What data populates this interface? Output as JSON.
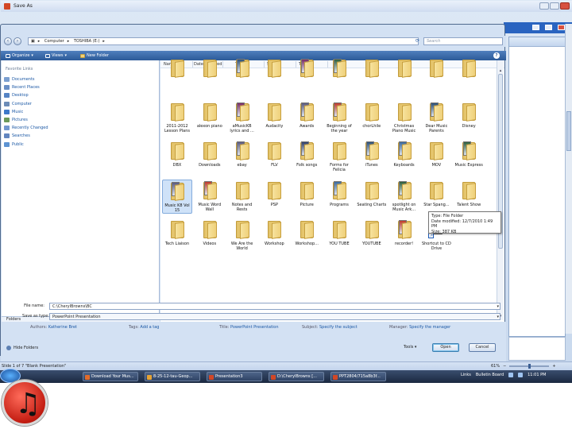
{
  "dialog": {
    "title": "Save As"
  },
  "address": {
    "crumbs": [
      "Computer",
      "TOSHIBA (E:)"
    ],
    "search_placeholder": "Search"
  },
  "toolbar": {
    "organize": "Organize",
    "views": "Views",
    "new_folder": "New Folder"
  },
  "sidebar": {
    "favorites_label": "Favorite Links",
    "items": [
      {
        "label": "Documents",
        "color": "#7b9fd0"
      },
      {
        "label": "Recent Places",
        "color": "#6a8fc6"
      },
      {
        "label": "Desktop",
        "color": "#5584c5"
      },
      {
        "label": "Computer",
        "color": "#6b8cb8"
      },
      {
        "label": "Music",
        "color": "#3d79c9"
      },
      {
        "label": "Pictures",
        "color": "#6b9a5a"
      },
      {
        "label": "Recently Changed",
        "color": "#7197cf"
      },
      {
        "label": "Searches",
        "color": "#6186c0"
      },
      {
        "label": "Public",
        "color": "#5c93d2"
      }
    ],
    "folders_label": "Folders"
  },
  "columns": [
    "Name",
    "Date modified",
    "Type",
    "Size",
    "Tags"
  ],
  "files": [
    {
      "name": "",
      "icon": "folder"
    },
    {
      "name": "",
      "icon": "folder"
    },
    {
      "name": "",
      "icon": "folder-pic"
    },
    {
      "name": "",
      "icon": "folder"
    },
    {
      "name": "",
      "icon": "folder-pic"
    },
    {
      "name": "",
      "icon": "folder-pic"
    },
    {
      "name": "",
      "icon": "folder"
    },
    {
      "name": "",
      "icon": "folder"
    },
    {
      "name": "",
      "icon": "folder"
    },
    {
      "name": "",
      "icon": "folder"
    },
    {
      "name": "2011-2012 Lesson Plans",
      "icon": "folder"
    },
    {
      "name": "alexon piano",
      "icon": "folder"
    },
    {
      "name": "aMusicKB lyrics and ...",
      "icon": "folder-pic"
    },
    {
      "name": "Audacity",
      "icon": "folder"
    },
    {
      "name": "Awards",
      "icon": "folder-pic"
    },
    {
      "name": "Beginning of the year",
      "icon": "folder-pic"
    },
    {
      "name": "chorLhile",
      "icon": "folder"
    },
    {
      "name": "Christmas Piano Music",
      "icon": "folder"
    },
    {
      "name": "Dear Music Parents",
      "icon": "folder-pic"
    },
    {
      "name": "Disney",
      "icon": "folder"
    },
    {
      "name": "DBX",
      "icon": "folder"
    },
    {
      "name": "Downloads",
      "icon": "folder"
    },
    {
      "name": "ebay",
      "icon": "folder-pic"
    },
    {
      "name": "FLV",
      "icon": "folder"
    },
    {
      "name": "Folk songs",
      "icon": "folder-pic"
    },
    {
      "name": "Forms for Felicia",
      "icon": "folder"
    },
    {
      "name": "iTunes",
      "icon": "folder-pic"
    },
    {
      "name": "Keyboards",
      "icon": "folder-pic"
    },
    {
      "name": "MOV",
      "icon": "folder"
    },
    {
      "name": "Music Express",
      "icon": "folder-pic"
    },
    {
      "name": "Music K8 Vol 15",
      "icon": "folder-pic"
    },
    {
      "name": "Music Word Wall",
      "icon": "folder-pic"
    },
    {
      "name": "Notes and Rests",
      "icon": "folder"
    },
    {
      "name": "PSP",
      "icon": "folder"
    },
    {
      "name": "Picture",
      "icon": "folder"
    },
    {
      "name": "Programs",
      "icon": "folder-pic"
    },
    {
      "name": "Seating Charts",
      "icon": "folder"
    },
    {
      "name": "spotlight on Music Ark...",
      "icon": "folder-pic"
    },
    {
      "name": "Star Spang...",
      "icon": "folder"
    },
    {
      "name": "Talent Show",
      "icon": "folder"
    },
    {
      "name": "Tech Liaison",
      "icon": "folder"
    },
    {
      "name": "Videos",
      "icon": "folder"
    },
    {
      "name": "We Are the World",
      "icon": "folder"
    },
    {
      "name": "Workshop",
      "icon": "folder"
    },
    {
      "name": "Workshop...",
      "icon": "folder"
    },
    {
      "name": "YOU TUBE",
      "icon": "folder"
    },
    {
      "name": "YOUTUBE",
      "icon": "folder"
    },
    {
      "name": "recorder!",
      "icon": "folder-pic"
    },
    {
      "name": "Shortcut to CD Drive",
      "icon": "drive"
    }
  ],
  "tooltip": {
    "type": "Type: File Folder",
    "date": "Date modified: 12/7/2010 1:49 PM",
    "size": "Size: 387 KB"
  },
  "form": {
    "filename_label": "File name:",
    "filename_value": "C:\\CherylBrowns\\BC",
    "savetype_label": "Save as type:",
    "savetype_value": "PowerPoint Presentation",
    "authors_label": "Authors:",
    "authors_value": "Katherine Bret",
    "tags_label": "Tags:",
    "tags_value": "Add a tag",
    "title_label": "Title:",
    "title_value": "PowerPoint Presentation",
    "subject_label": "Subject:",
    "subject_value": "Specify the subject",
    "manager_label": "Manager:",
    "manager_value": "Specify the manager"
  },
  "footer": {
    "hide_folders": "Hide Folders",
    "tools": "Tools",
    "open": "Open",
    "cancel": "Cancel"
  },
  "statusbar": {
    "left": "Slide 1 of 7    \"Blank Presentation\"",
    "zoom": "61%"
  },
  "taskbar": {
    "buttons": [
      {
        "label": "Download Your Mus...",
        "color": "#e26b2a"
      },
      {
        "label": "8-25-12-tau-Geop...",
        "color": "#e7a332"
      },
      {
        "label": "Presentation3",
        "color": "#d24726"
      },
      {
        "label": "D:\\CherylBrowns [...",
        "color": "#d24726"
      },
      {
        "label": "PPT2804/715a8b3f...",
        "color": "#d24726"
      }
    ],
    "links": "Links",
    "bulletin": "Bulletin Board",
    "time": "11:01 PM"
  }
}
